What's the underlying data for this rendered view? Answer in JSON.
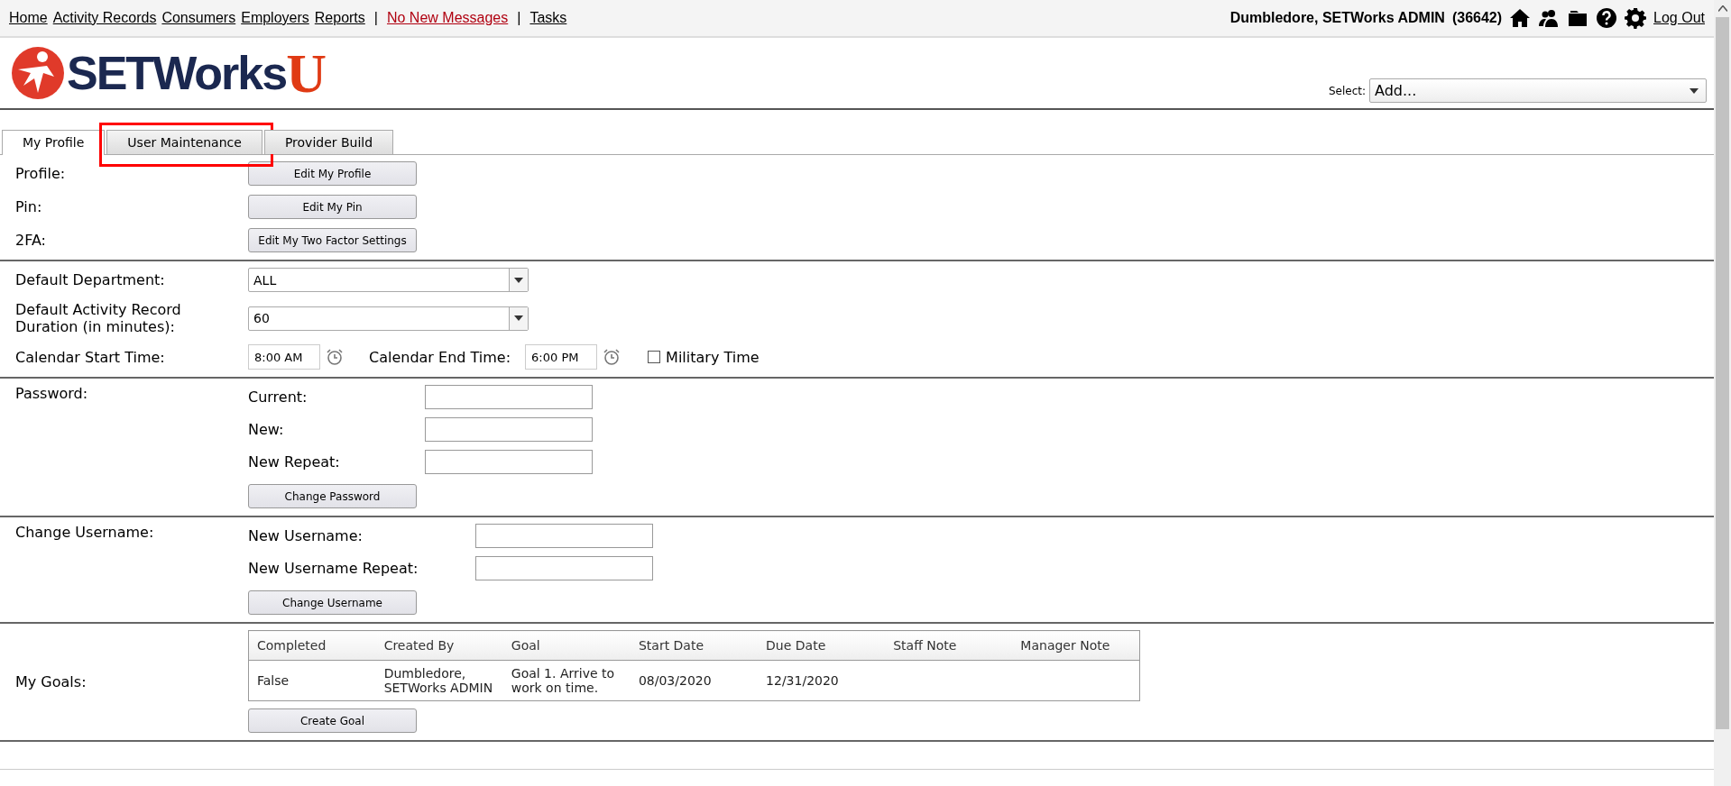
{
  "top_nav": {
    "items": [
      {
        "kind": "link",
        "label": "Home"
      },
      {
        "kind": "link",
        "label": "Activity Records"
      },
      {
        "kind": "link",
        "label": "Consumers"
      },
      {
        "kind": "link",
        "label": "Employers"
      },
      {
        "kind": "link",
        "label": "Reports"
      },
      {
        "kind": "separator",
        "label": "|"
      },
      {
        "kind": "alert",
        "label": "No New Messages"
      },
      {
        "kind": "separator",
        "label": "|"
      },
      {
        "kind": "link",
        "label": "Tasks"
      }
    ],
    "user": "Dumbledore, SETWorks ADMIN",
    "user_id": "(36642)",
    "logout": "Log Out"
  },
  "logo": {
    "name": "SETWorks",
    "letter": "U"
  },
  "select": {
    "label": "Select:",
    "value": "Add..."
  },
  "tabs": [
    {
      "label": "My Profile",
      "selected": true,
      "highlighted": false
    },
    {
      "label": "User Maintenance",
      "selected": false,
      "highlighted": true
    },
    {
      "label": "Provider Build",
      "selected": false,
      "highlighted": false
    }
  ],
  "profile_rows": [
    {
      "label": "Profile:",
      "button": "Edit My Profile"
    },
    {
      "label": "Pin:",
      "button": "Edit My Pin"
    },
    {
      "label": "2FA:",
      "button": "Edit My Two Factor Settings"
    }
  ],
  "preferences": {
    "department": {
      "label": "Default Department:",
      "value": "ALL"
    },
    "duration": {
      "label": "Default Activity Record Duration (in minutes):",
      "value": "60"
    },
    "calendar": {
      "start_label": "Calendar Start Time:",
      "start_value": "8:00 AM",
      "end_label": "Calendar End Time:",
      "end_value": "6:00 PM",
      "military_label": "Military Time",
      "military_checked": false
    }
  },
  "password": {
    "label": "Password:",
    "fields": [
      "Current:",
      "New:",
      "New Repeat:"
    ],
    "button": "Change Password"
  },
  "username": {
    "label": "Change Username:",
    "fields": [
      "New Username:",
      "New Username Repeat:"
    ],
    "button": "Change Username"
  },
  "goals": {
    "label": "My Goals:",
    "columns": [
      "Completed",
      "Created By",
      "Goal",
      "Start Date",
      "Due Date",
      "Staff Note",
      "Manager Note"
    ],
    "rows": [
      [
        "False",
        "Dumbledore, SETWorks ADMIN",
        "Goal 1. Arrive to work on time.",
        "08/03/2020",
        "12/31/2020"
      ]
    ],
    "button": "Create Goal"
  }
}
